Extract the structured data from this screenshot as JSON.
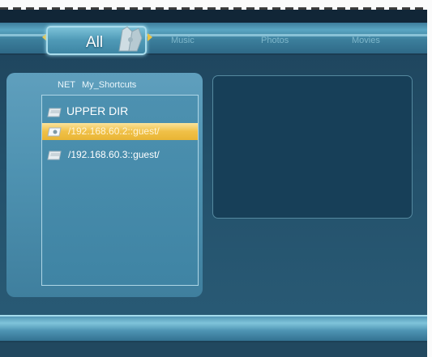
{
  "tabs": {
    "all": "All",
    "music": "Music",
    "photos": "Photos",
    "movies": "Movies"
  },
  "breadcrumb": {
    "source": "NET",
    "folder": "My_Shortcuts"
  },
  "file_list": [
    {
      "label": "UPPER DIR",
      "icon": "folder-icon",
      "selected": false
    },
    {
      "label": "/192.168.60.2::guest/",
      "icon": "network-folder-icon",
      "selected": true
    },
    {
      "label": "/192.168.60.3::guest/",
      "icon": "folder-icon",
      "selected": false
    }
  ],
  "colors": {
    "selection": "#f0c047",
    "panel": "#4e92b1",
    "preview": "#173f58"
  }
}
